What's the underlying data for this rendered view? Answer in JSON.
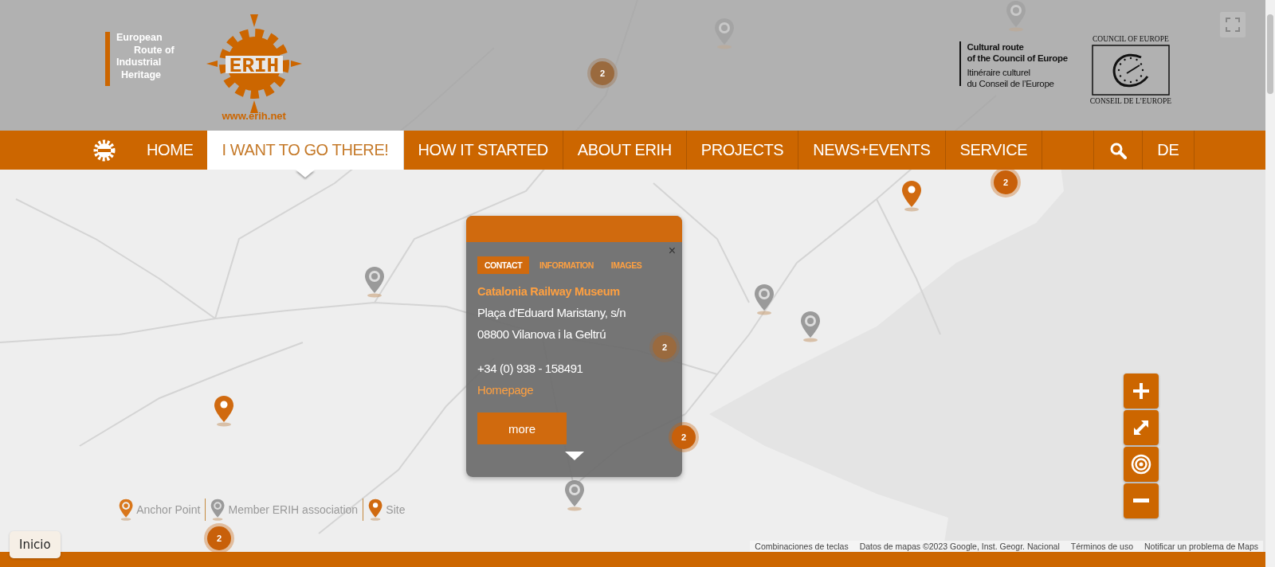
{
  "header": {
    "logo_lines": [
      "European",
      "Route of",
      "Industrial",
      "Heritage"
    ],
    "logo_lettering": "ERIH",
    "logo_url": "www.erih.net",
    "council_lines": [
      "Cultural route",
      "of the Council of Europe"
    ],
    "council_lines_fr": [
      "Itinéraire culturel",
      "du Conseil de l’Europe"
    ],
    "council_emblem_top": "COUNCIL OF EUROPE",
    "council_emblem_bottom": "CONSEIL DE L’EUROPE"
  },
  "nav": {
    "items": [
      {
        "label": "HOME",
        "selected": false
      },
      {
        "label": "I WANT TO GO THERE!",
        "selected": true
      },
      {
        "label": "HOW IT STARTED",
        "selected": false
      },
      {
        "label": "ABOUT ERIH",
        "selected": false
      },
      {
        "label": "PROJECTS",
        "selected": false
      },
      {
        "label": "NEWS+EVENTS",
        "selected": false
      },
      {
        "label": "SERVICE",
        "selected": false
      }
    ],
    "language": "DE"
  },
  "map": {
    "clusters": [
      {
        "count": "2"
      },
      {
        "count": "2"
      },
      {
        "count": "2"
      },
      {
        "count": "2"
      },
      {
        "count": "2"
      }
    ],
    "pins": [
      {
        "kind": "member"
      },
      {
        "kind": "member"
      },
      {
        "kind": "member"
      },
      {
        "kind": "member"
      },
      {
        "kind": "member"
      },
      {
        "kind": "member"
      },
      {
        "kind": "site"
      },
      {
        "kind": "site"
      }
    ]
  },
  "popup": {
    "tabs": [
      {
        "label": "CONTACT",
        "selected": true
      },
      {
        "label": "INFORMATION",
        "selected": false
      },
      {
        "label": "IMAGES",
        "selected": false
      }
    ],
    "title": "Catalonia Railway Museum",
    "address": [
      "Plaça d'Eduard Maristany, s/n",
      "08800 Vilanova i la Geltrú"
    ],
    "phone": "+34 (0) 938 - 158491",
    "close": "×",
    "link": "Homepage",
    "button": "more"
  },
  "legend": [
    {
      "kind": "anchor",
      "label": "Anchor Point"
    },
    {
      "kind": "member",
      "label": "Member ERIH association"
    },
    {
      "kind": "site",
      "label": "Site"
    }
  ],
  "home_chip": "Inicio",
  "attribution": [
    "Combinaciones de teclas",
    "Datos de mapas ©2023 Google, Inst. Geogr. Nacional",
    "Términos de uso",
    "Notificar un problema de Maps"
  ]
}
